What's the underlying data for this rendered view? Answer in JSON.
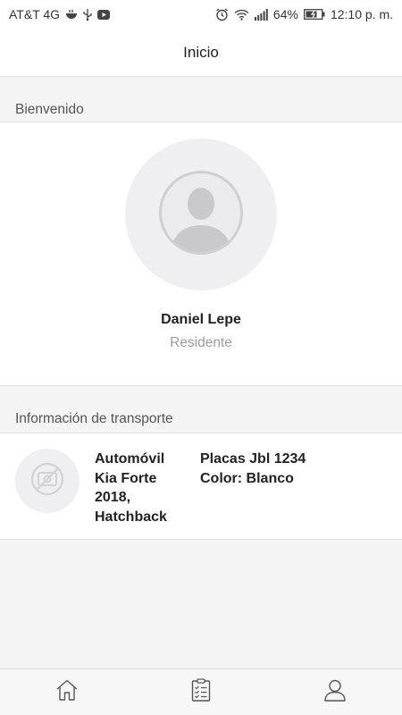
{
  "status_bar": {
    "carrier": "AT&T 4G",
    "battery_percent": "64%",
    "time": "12:10 p. m.",
    "icons": [
      "bowl-icon",
      "usb-icon",
      "youtube-icon",
      "alarm-icon",
      "wifi-icon",
      "signal-icon",
      "battery-charging-icon"
    ]
  },
  "header": {
    "title": "Inicio"
  },
  "welcome": {
    "section_label": "Bienvenido",
    "avatar_icon": "user-placeholder-icon",
    "name": "Daniel Lepe",
    "role": "Residente"
  },
  "transport": {
    "section_label": "Información de transporte",
    "thumb_icon": "no-photo-icon",
    "vehicle": {
      "line1": "Automóvil",
      "line2": "Kia Forte",
      "line3": "2018,",
      "line4": "Hatchback"
    },
    "plates": "Placas Jbl 1234",
    "color": "Color: Blanco"
  },
  "bottom_nav": {
    "items": [
      {
        "icon": "home-icon"
      },
      {
        "icon": "checklist-icon"
      },
      {
        "icon": "profile-icon"
      }
    ]
  },
  "colors": {
    "background": "#f4f4f5",
    "card": "#ffffff",
    "placeholder": "#efeff1",
    "muted_text": "#9c9c9c"
  }
}
